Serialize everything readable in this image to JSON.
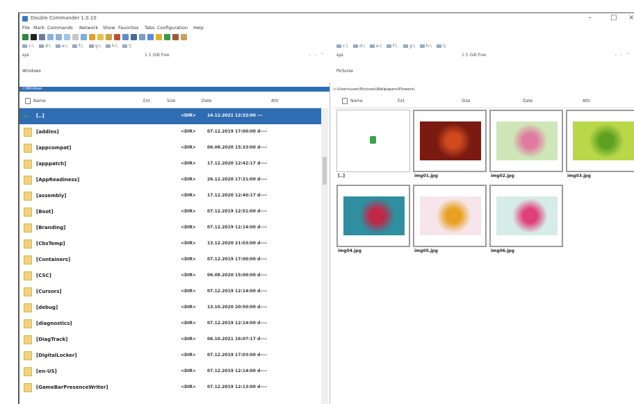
{
  "window": {
    "title": "Double Commander 1.0.10",
    "controls": [
      "–",
      "□",
      "×"
    ]
  },
  "menu": [
    "File",
    "Mark",
    "Commands",
    "Network",
    "Show",
    "Favorites",
    "Tabs",
    "Configuration",
    "Help"
  ],
  "left_panel": {
    "tab": "sys",
    "free_space": "1.5 GiB free",
    "breadcrumb": "Windows",
    "active_path": "c:\\Windows",
    "columns": [
      "Name",
      "Ext",
      "Size",
      "Date",
      "Attr"
    ],
    "rows": [
      {
        "name": "[..]",
        "ext": "<DIR>",
        "date": "14.12.2021 12:32:00 ---",
        "selected": true,
        "icon": "back-icon"
      },
      {
        "name": "[addins]",
        "ext": "<DIR>",
        "date": "07.12.2019 17:00:00 d----"
      },
      {
        "name": "[appcompat]",
        "ext": "<DIR>",
        "date": "06.08.2020 15:33:00 d----"
      },
      {
        "name": "[apppatch]",
        "ext": "<DIR>",
        "date": "17.12.2020 12:42:17 d----"
      },
      {
        "name": "[AppReadiness]",
        "ext": "<DIR>",
        "date": "26.12.2020 17:31:00 d----"
      },
      {
        "name": "[assembly]",
        "ext": "<DIR>",
        "date": "17.12.2020 12:40:17 d----"
      },
      {
        "name": "[Boot]",
        "ext": "<DIR>",
        "date": "07.12.2019 12:51:00 d----"
      },
      {
        "name": "[Branding]",
        "ext": "<DIR>",
        "date": "07.12.2019 12:14:00 d----"
      },
      {
        "name": "[CbsTemp]",
        "ext": "<DIR>",
        "date": "13.12.2020 21:03:00 d----"
      },
      {
        "name": "[Containers]",
        "ext": "<DIR>",
        "date": "07.12.2019 17:00:00 d----"
      },
      {
        "name": "[CSC]",
        "ext": "<DIR>",
        "date": "06.08.2020 15:00:00 d----"
      },
      {
        "name": "[Cursors]",
        "ext": "<DIR>",
        "date": "07.12.2019 12:14:00 d----"
      },
      {
        "name": "[debug]",
        "ext": "<DIR>",
        "date": "13.10.2020 20:50:00 d----"
      },
      {
        "name": "[diagnostics]",
        "ext": "<DIR>",
        "date": "07.12.2019 12:14:00 d----"
      },
      {
        "name": "[DiagTrack]",
        "ext": "<DIR>",
        "date": "06.10.2021 16:07:17 d----"
      },
      {
        "name": "[DigitalLocker]",
        "ext": "<DIR>",
        "date": "07.12.2019 17:03:00 d----"
      },
      {
        "name": "[en-US]",
        "ext": "<DIR>",
        "date": "07.12.2019 12:14:00 d----"
      },
      {
        "name": "[GameBarPresenceWriter]",
        "ext": "<DIR>",
        "date": "07.12.2019 12:13:00 d----"
      }
    ]
  },
  "right_panel": {
    "tab": "sys",
    "free_space": "1.5 GiB free",
    "breadcrumb": "Pictures",
    "active_path": "c:\\Users\\user\\Pictures\\Wallpapers\\Flowers\\",
    "columns": [
      "Name",
      "Ext",
      "Size",
      "Date",
      "Attr"
    ],
    "tiles": [
      {
        "caption": "[..]",
        "kind": "up"
      },
      {
        "caption": "img01.jpg",
        "kind": "photo",
        "bg": "#7a1a10",
        "accent": "#d04a20"
      },
      {
        "caption": "img02.jpg",
        "kind": "photo",
        "bg": "#cfe6b8",
        "accent": "#e07aa0"
      },
      {
        "caption": "img03.jpg",
        "kind": "photo",
        "bg": "#b8d84a",
        "accent": "#5ea020"
      },
      {
        "caption": "img04.jpg",
        "kind": "photo",
        "bg": "#2f8ea0",
        "accent": "#c02848"
      },
      {
        "caption": "img05.jpg",
        "kind": "photo",
        "bg": "#f6e6ec",
        "accent": "#e8a020"
      },
      {
        "caption": "img06.jpg",
        "kind": "photo",
        "bg": "#d6ece8",
        "accent": "#e0407a"
      }
    ]
  },
  "drives": [
    "c:\\",
    "d:\\",
    "e:\\",
    "f:\\",
    "g:\\",
    "h:\\",
    "\\\\"
  ],
  "colors": {
    "accent": "#2f6db3",
    "folder": "#f0d27a"
  }
}
